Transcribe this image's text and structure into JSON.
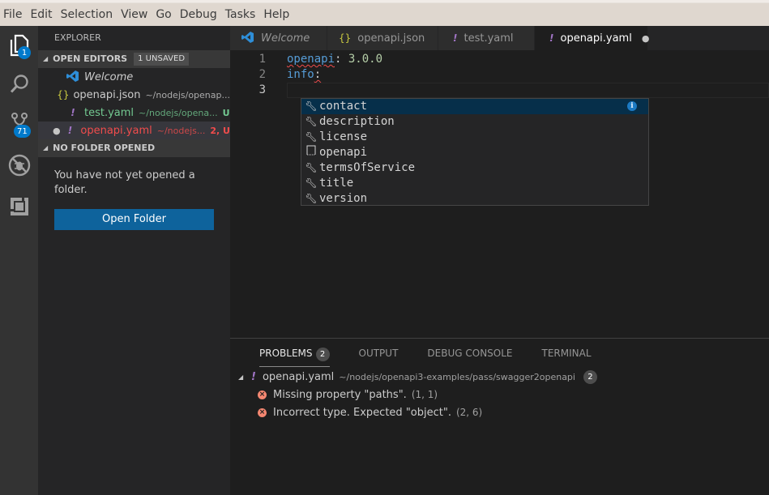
{
  "menu": [
    "File",
    "Edit",
    "Selection",
    "View",
    "Go",
    "Debug",
    "Tasks",
    "Help"
  ],
  "activity_bar": {
    "items": [
      {
        "name": "explorer",
        "icon": "files-icon",
        "badge": "1"
      },
      {
        "name": "search",
        "icon": "search-icon",
        "badge": null
      },
      {
        "name": "source-control",
        "icon": "source-control-icon",
        "badge": "71"
      },
      {
        "name": "debug",
        "icon": "debug-icon",
        "badge": null
      },
      {
        "name": "extensions",
        "icon": "extensions-icon",
        "badge": null
      }
    ]
  },
  "sidebar": {
    "title": "EXPLORER",
    "open_editors": {
      "label": "OPEN EDITORS",
      "badge": "1 UNSAVED",
      "items": [
        {
          "icon": "vscode-icon",
          "name": "Welcome",
          "path": "",
          "status": "",
          "color": "#cccccc",
          "dirty": false
        },
        {
          "icon": "json-icon",
          "glyph": "{}",
          "name": "openapi.json",
          "path": "~/nodejs/openap...",
          "status": "",
          "color": "#cccccc",
          "dirty": false
        },
        {
          "icon": "yaml-icon",
          "glyph": "!",
          "name": "test.yaml",
          "path": "~/nodejs/opena...",
          "status": "U",
          "color": "#73c991",
          "dirty": false
        },
        {
          "icon": "yaml-icon",
          "glyph": "!",
          "name": "openapi.yaml",
          "path": "~/nodejs...",
          "status": "2, U",
          "color": "#f14c4c",
          "dirty": true
        }
      ]
    },
    "no_folder": {
      "label": "NO FOLDER OPENED",
      "message": "You have not yet opened a folder.",
      "button": "Open Folder"
    }
  },
  "tabs": [
    {
      "label": "Welcome",
      "icon": "vscode-icon",
      "active": false,
      "italic": true
    },
    {
      "label": "openapi.json",
      "icon": "json-icon",
      "glyph": "{}",
      "active": false
    },
    {
      "label": "test.yaml",
      "icon": "yaml-icon",
      "glyph": "!",
      "active": false
    },
    {
      "label": "openapi.yaml",
      "icon": "yaml-icon",
      "glyph": "!",
      "active": true,
      "dirty": true
    }
  ],
  "editor": {
    "lines": [
      {
        "num": "1",
        "key": "openapi",
        "sep": ":",
        "value": " 3.0.0"
      },
      {
        "num": "2",
        "key": "info",
        "sep": ":",
        "value": ""
      },
      {
        "num": "3",
        "key": "",
        "sep": "",
        "value": ""
      }
    ]
  },
  "suggest": {
    "items": [
      {
        "label": "contact",
        "icon": "wrench-icon",
        "selected": true
      },
      {
        "label": "description",
        "icon": "wrench-icon"
      },
      {
        "label": "license",
        "icon": "wrench-icon"
      },
      {
        "label": "openapi",
        "icon": "snippet-icon"
      },
      {
        "label": "termsOfService",
        "icon": "wrench-icon"
      },
      {
        "label": "title",
        "icon": "wrench-icon"
      },
      {
        "label": "version",
        "icon": "wrench-icon"
      }
    ],
    "info_glyph": "i"
  },
  "panel": {
    "tabs": [
      {
        "label": "PROBLEMS",
        "badge": "2",
        "active": true
      },
      {
        "label": "OUTPUT"
      },
      {
        "label": "DEBUG CONSOLE"
      },
      {
        "label": "TERMINAL"
      }
    ],
    "file": {
      "name": "openapi.yaml",
      "path": "~/nodejs/openapi3-examples/pass/swagger2openapi",
      "count": "2"
    },
    "problems": [
      {
        "message": "Missing property \"paths\".",
        "location": "(1, 1)"
      },
      {
        "message": "Incorrect type. Expected \"object\".",
        "location": "(2, 6)"
      }
    ]
  },
  "colors": {
    "accent": "#007acc",
    "button": "#0e639c",
    "error": "#f48771",
    "yaml_icon": "#a074c4",
    "json_icon": "#cbcb41",
    "untracked": "#73c991",
    "modified_error": "#f14c4c"
  }
}
